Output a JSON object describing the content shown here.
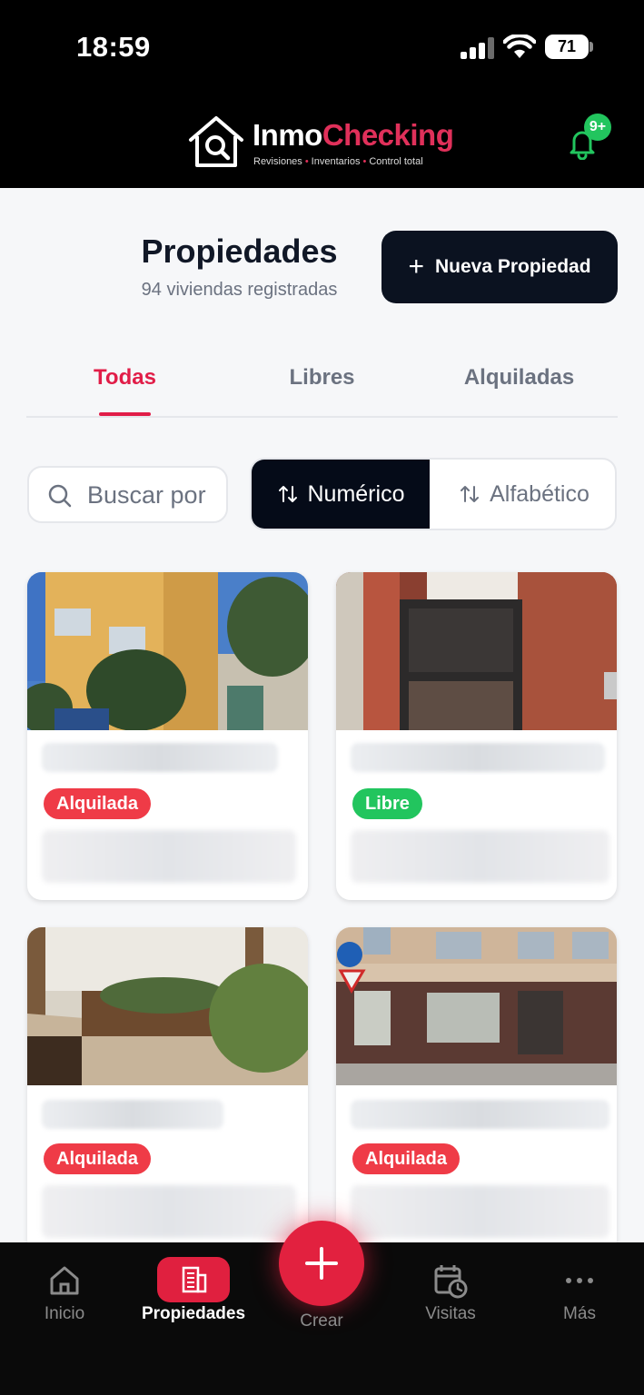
{
  "status_bar": {
    "time": "18:59",
    "battery": "71"
  },
  "header": {
    "brand_part1": "Inmo",
    "brand_part2": "Checking",
    "tagline": [
      "Revisiones",
      "Inventarios",
      "Control total"
    ],
    "notifications_badge": "9+"
  },
  "page": {
    "title": "Propiedades",
    "subtitle": "94 viviendas registradas",
    "new_button_label": "Nueva Propiedad"
  },
  "tabs": [
    {
      "label": "Todas",
      "active": true
    },
    {
      "label": "Libres",
      "active": false
    },
    {
      "label": "Alquiladas",
      "active": false
    }
  ],
  "search": {
    "placeholder": "Buscar por"
  },
  "sort": [
    {
      "label": "Numérico",
      "active": true
    },
    {
      "label": "Alfabético",
      "active": false
    }
  ],
  "properties": [
    {
      "status": "Alquilada"
    },
    {
      "status": "Libre"
    },
    {
      "status": "Alquilada"
    },
    {
      "status": "Alquilada"
    }
  ],
  "bottom_nav": {
    "items": [
      {
        "label": "Inicio",
        "icon": "home-icon"
      },
      {
        "label": "Propiedades",
        "icon": "building-icon",
        "active": true
      },
      {
        "label": "Crear",
        "icon": "plus-icon"
      },
      {
        "label": "Visitas",
        "icon": "calendar-clock-icon"
      },
      {
        "label": "Más",
        "icon": "more-icon"
      }
    ]
  },
  "colors": {
    "accent": "#e11d48",
    "rented": "#ef3b47",
    "free": "#22c55e",
    "dark": "#0b1220"
  }
}
